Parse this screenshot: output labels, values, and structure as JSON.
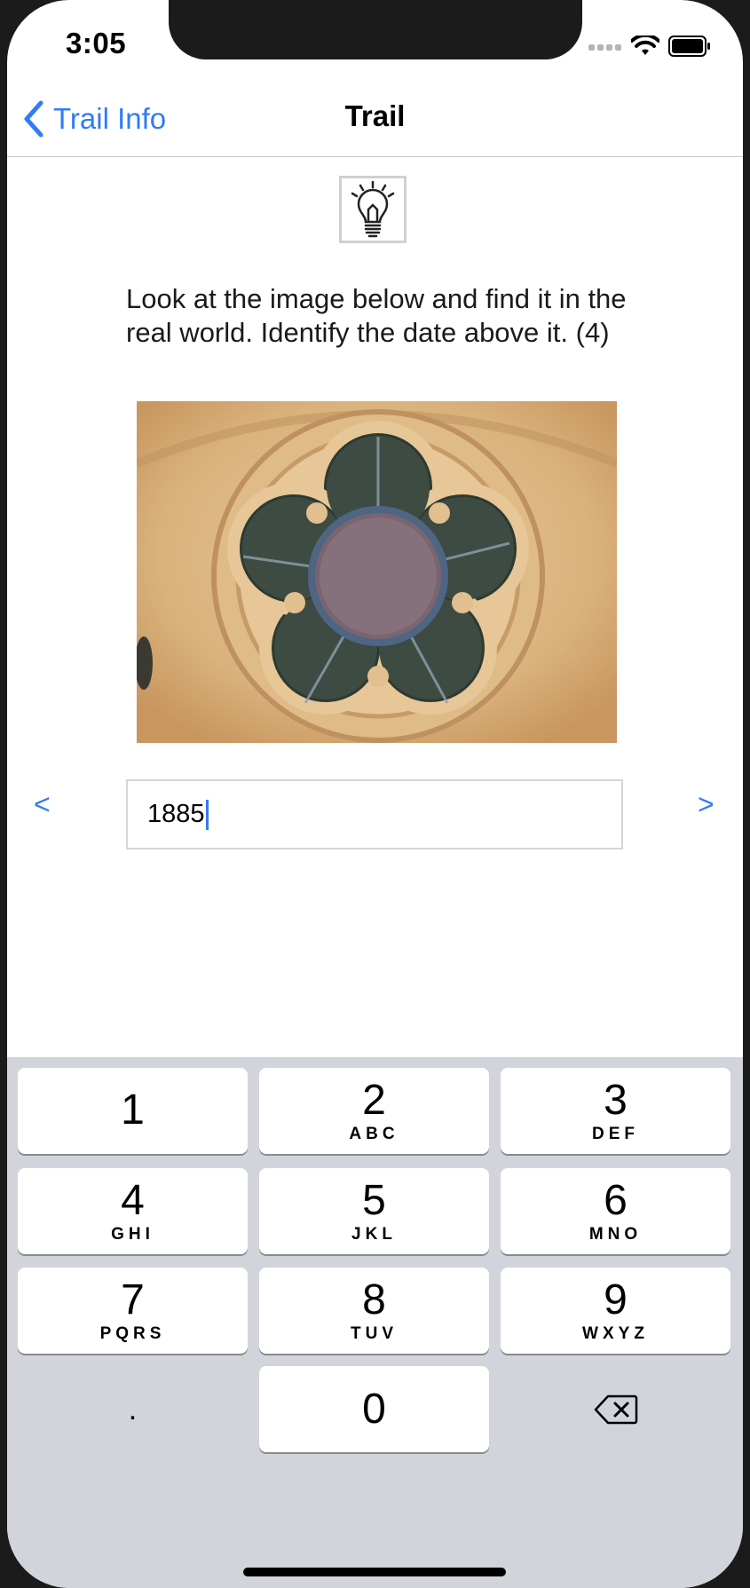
{
  "status_bar": {
    "time": "3:05"
  },
  "nav_bar": {
    "back_label": "Trail Info",
    "title": "Trail"
  },
  "question": {
    "text": "Look at the image below and find it in the real world. Identify the date above it. (4)"
  },
  "photo": {
    "subject": "rose window"
  },
  "answer": {
    "value": "1885"
  },
  "pager": {
    "prev_label": "<",
    "next_label": ">"
  },
  "keypad": {
    "keys": [
      {
        "digit": "1",
        "letters": ""
      },
      {
        "digit": "2",
        "letters": "ABC"
      },
      {
        "digit": "3",
        "letters": "DEF"
      },
      {
        "digit": "4",
        "letters": "GHI"
      },
      {
        "digit": "5",
        "letters": "JKL"
      },
      {
        "digit": "6",
        "letters": "MNO"
      },
      {
        "digit": "7",
        "letters": "PQRS"
      },
      {
        "digit": "8",
        "letters": "TUV"
      },
      {
        "digit": "9",
        "letters": "WXYZ"
      },
      {
        "digit": "0",
        "letters": ""
      }
    ],
    "decimal_label": "."
  },
  "colors": {
    "accent": "#2f7cf6",
    "keyboard_bg": "#d1d4da",
    "key_bg": "#ffffff"
  }
}
